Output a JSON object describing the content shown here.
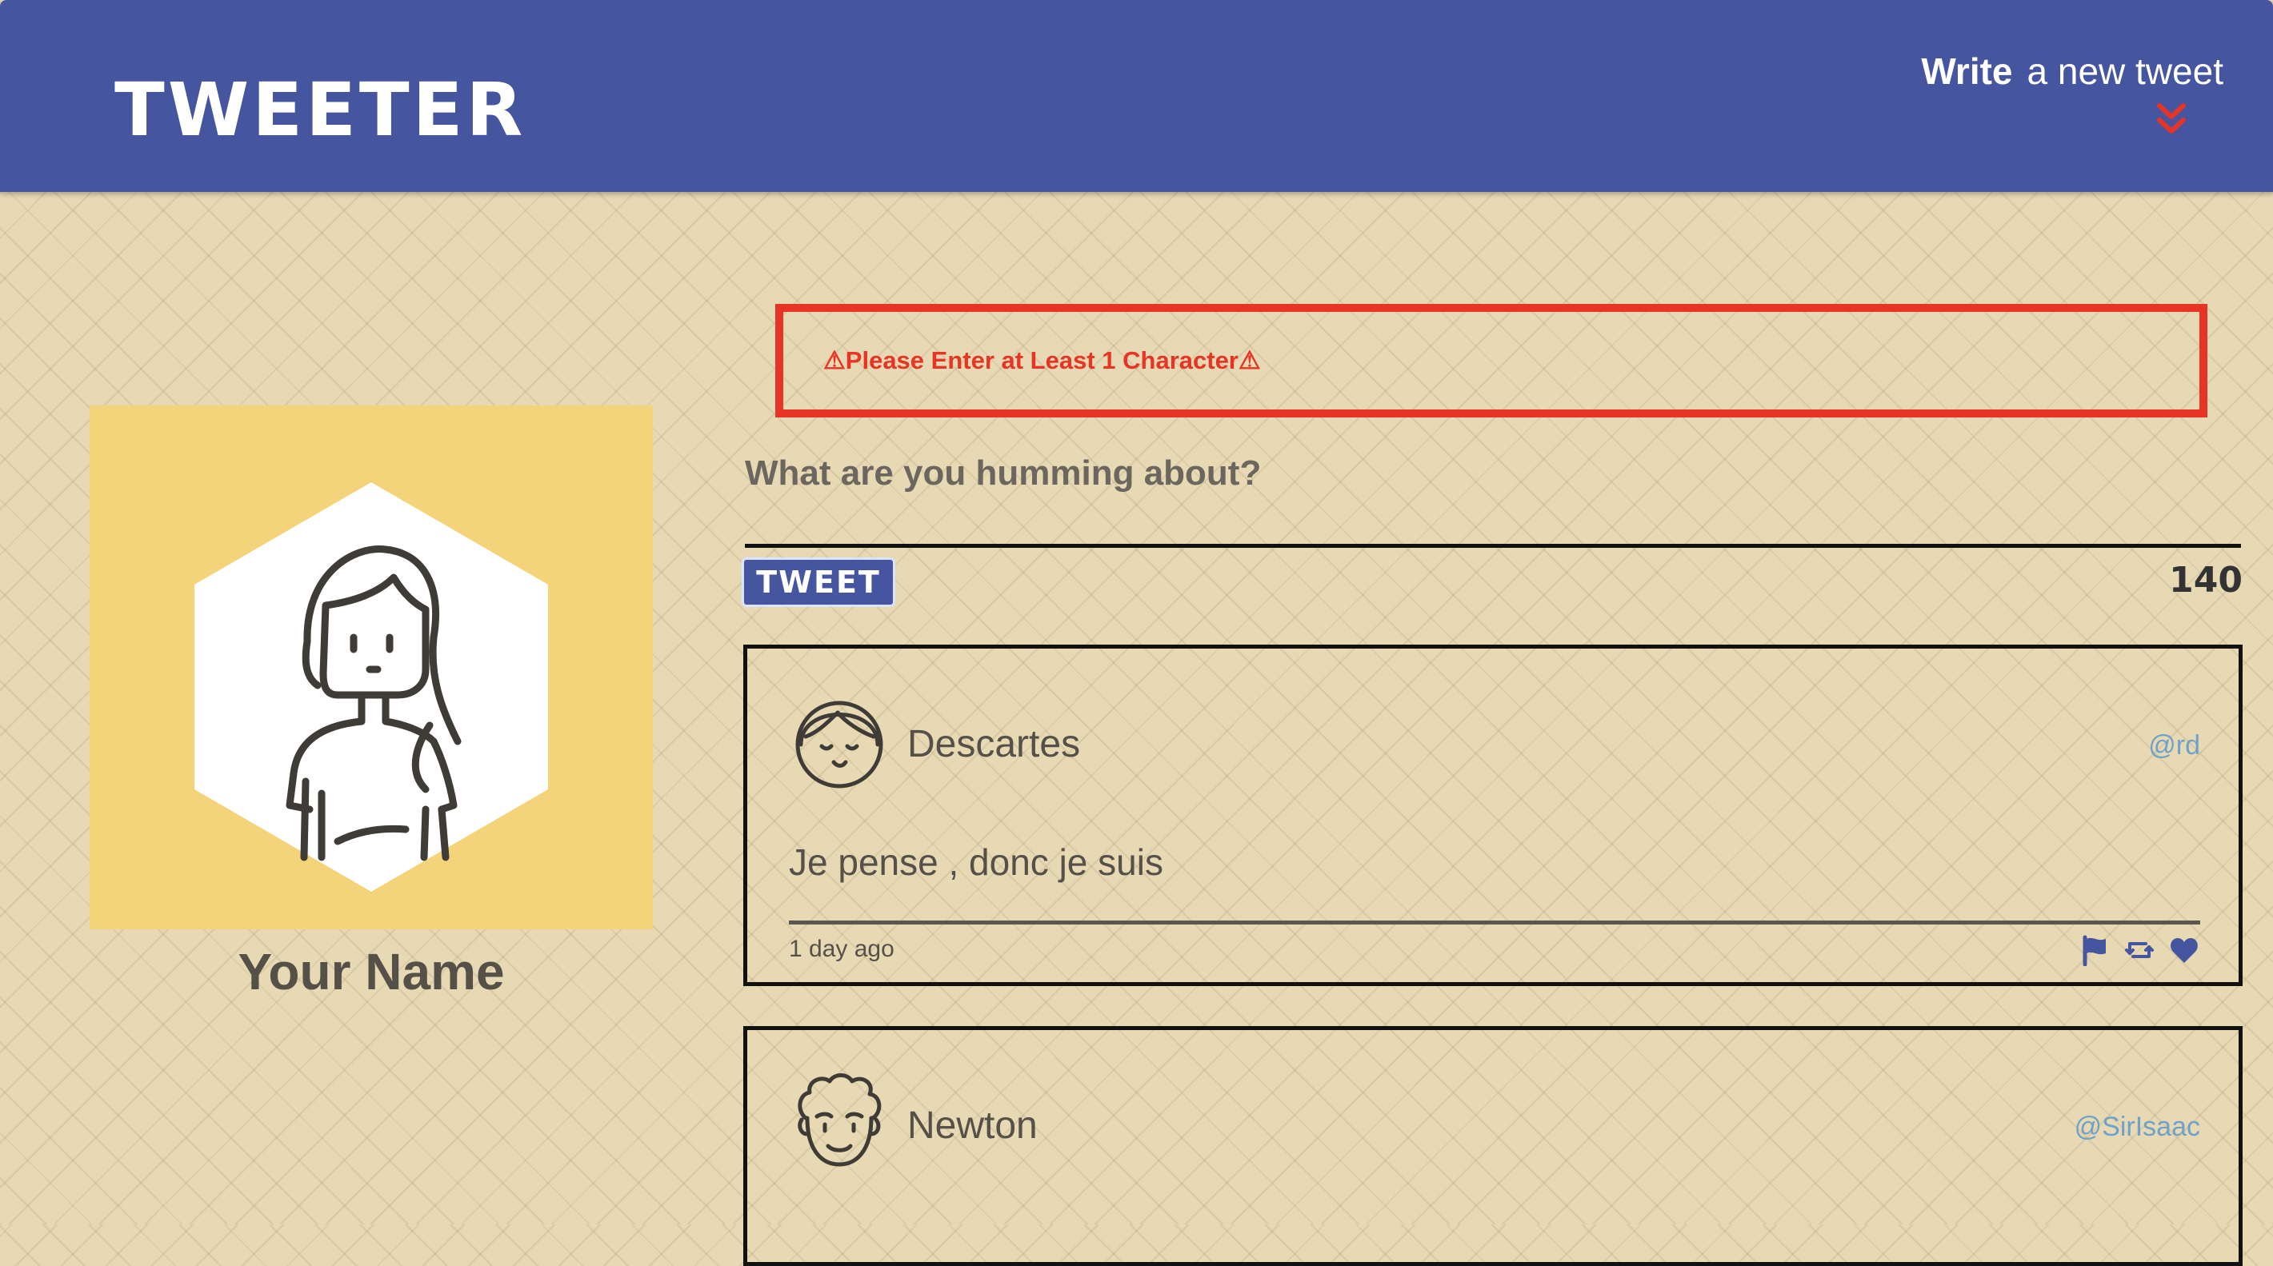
{
  "header": {
    "brand": "TWEETER",
    "compose_strong": "Write",
    "compose_rest": "a new tweet",
    "toggle_icon": "double-chevron-down-icon"
  },
  "profile": {
    "name": "Your Name",
    "avatar_icon": "girl-avatar-icon"
  },
  "compose": {
    "error": "⚠Please Enter at Least 1 Character⚠",
    "placeholder": "What are you humming about?",
    "value": "",
    "button_label": "TWEET",
    "counter": "140"
  },
  "tweets": [
    {
      "name": "Descartes",
      "handle": "@rd",
      "content": "Je pense , donc je suis",
      "time": "1 day ago",
      "avatar_icon": "girl-face-avatar-icon",
      "actions": [
        "flag-icon",
        "retweet-icon",
        "heart-icon"
      ]
    },
    {
      "name": "Newton",
      "handle": "@SirIsaac",
      "avatar_icon": "curly-hair-face-avatar-icon"
    }
  ],
  "colors": {
    "header": "#4555a0",
    "background": "#e6d9b4",
    "avatar_bg": "#f3d47a",
    "error": "#e83424",
    "handle": "#6fa1c9",
    "icon": "#4555a0"
  }
}
